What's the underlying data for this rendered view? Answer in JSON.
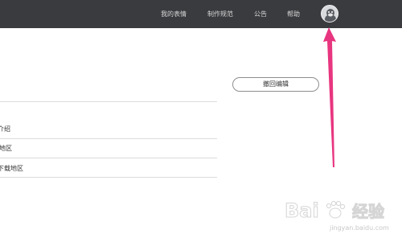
{
  "nav": {
    "items": [
      {
        "label": "我的表情"
      },
      {
        "label": "制作规范"
      },
      {
        "label": "公告"
      },
      {
        "label": "帮助"
      }
    ],
    "avatar_icon": "user-avatar-icon"
  },
  "main": {
    "withdraw_button": "撤回编辑",
    "list": [
      {
        "label": "介绍"
      },
      {
        "label": "地区"
      },
      {
        "label": "下载地区"
      }
    ]
  },
  "annotation": {
    "arrow_color": "#e8357f"
  },
  "watermark": {
    "brand": "Bai",
    "brand2": "经验",
    "url": "jingyan.baidu.com"
  }
}
